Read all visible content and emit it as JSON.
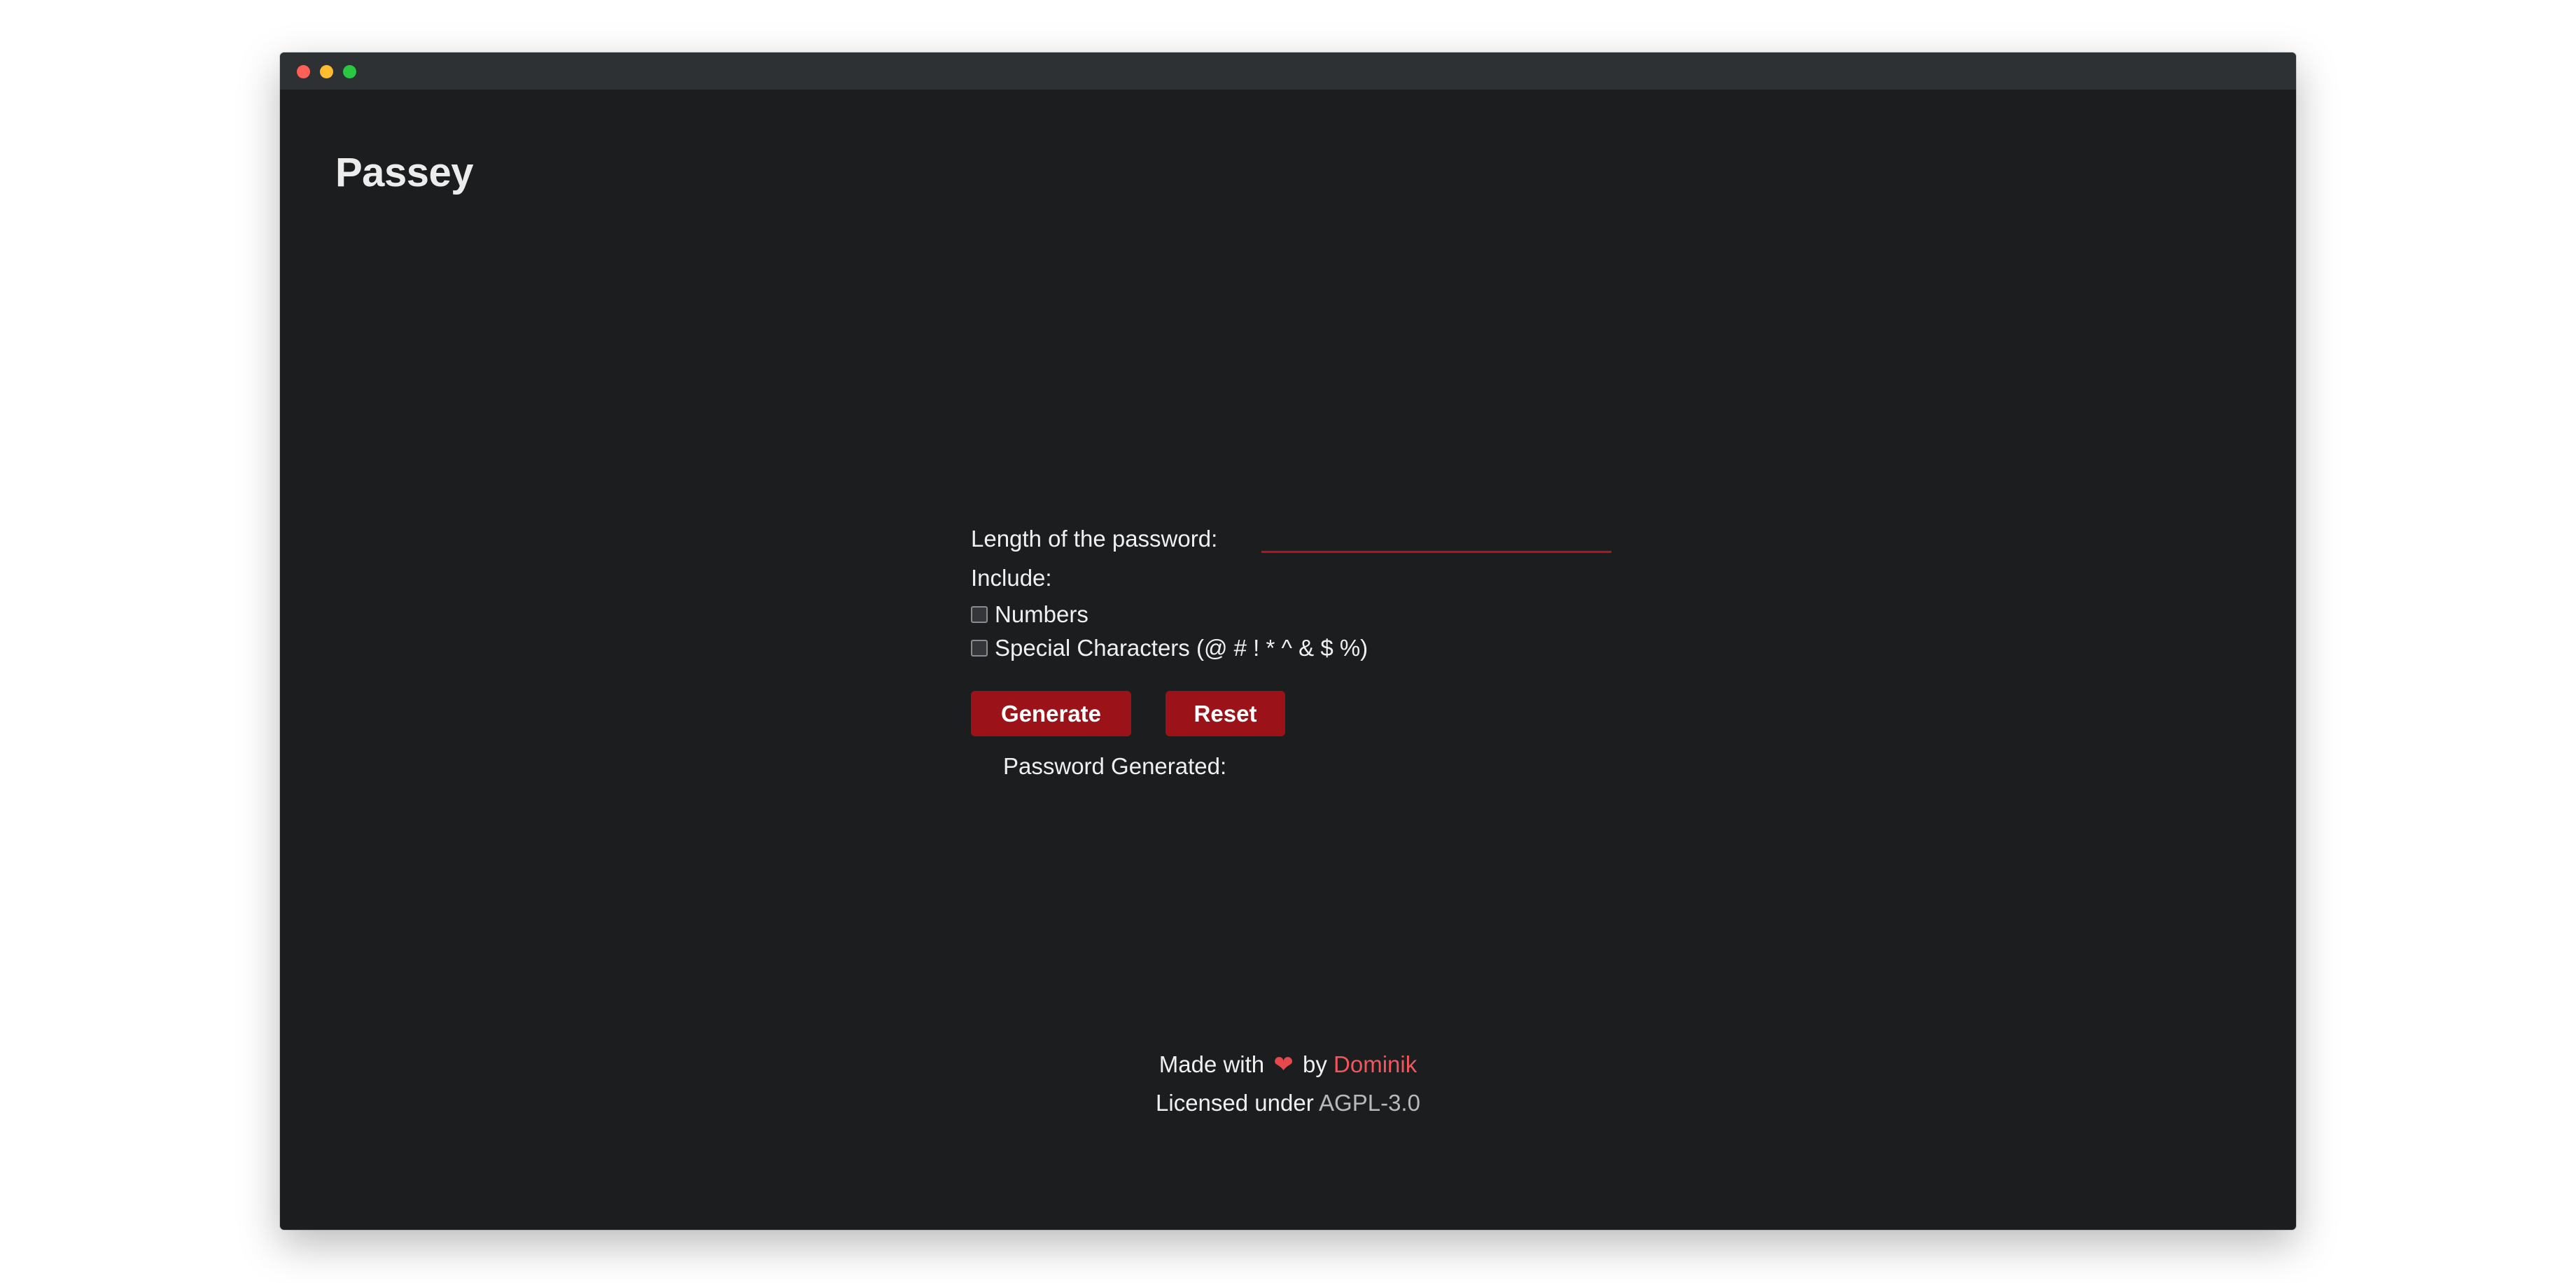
{
  "window": {
    "controls": [
      "close",
      "minimize",
      "maximize"
    ]
  },
  "app": {
    "title": "Passey"
  },
  "form": {
    "length_label": "Length of the password:",
    "length_value": "",
    "include_label": "Include:",
    "options": [
      {
        "label": "Numbers",
        "checked": false
      },
      {
        "label": "Special Characters (@ # ! * ^ & $ %)",
        "checked": false
      }
    ],
    "generate_label": "Generate",
    "reset_label": "Reset",
    "generated_label": "Password Generated:",
    "generated_value": ""
  },
  "footer": {
    "made_with": "Made with",
    "heart": "❤",
    "by": "by",
    "author": "Dominik",
    "licensed_under": "Licensed under",
    "license": "AGPL-3.0"
  },
  "colors": {
    "background": "#1c1d1f",
    "titlebar": "#2e3133",
    "accent": "#9b1318",
    "input_underline": "#b0161c",
    "author_link": "#f0565b",
    "license_link": "#b9b9b9"
  }
}
